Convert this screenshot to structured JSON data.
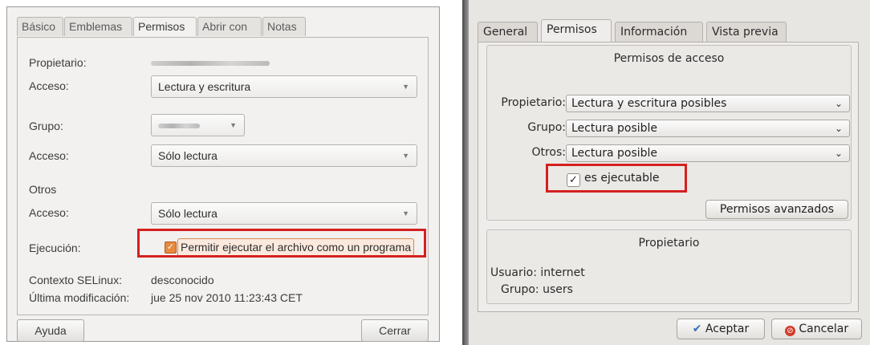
{
  "left_dialog": {
    "tabs": [
      {
        "label": "Básico"
      },
      {
        "label": "Emblemas"
      },
      {
        "label": "Permisos"
      },
      {
        "label": "Abrir con"
      },
      {
        "label": "Notas"
      }
    ],
    "active_tab": "Permisos",
    "owner_label": "Propietario:",
    "owner_access_label": "Acceso:",
    "owner_access_value": "Lectura y escritura",
    "group_label": "Grupo:",
    "group_access_label": "Acceso:",
    "group_access_value": "Sólo lectura",
    "others_label": "Otros",
    "others_access_label": "Acceso:",
    "others_access_value": "Sólo lectura",
    "execution_label": "Ejecución:",
    "execution_checkbox_label": "Permitir ejecutar el archivo como un programa",
    "execution_checked": true,
    "selinux_label": "Contexto SELinux:",
    "selinux_value": "desconocido",
    "modified_label": "Última modificación:",
    "modified_value": "jue 25 nov 2010 11:23:43 CET",
    "help_button": "Ayuda",
    "close_button": "Cerrar"
  },
  "right_dialog": {
    "tabs": [
      {
        "label": "General"
      },
      {
        "label": "Permisos"
      },
      {
        "label": "Información"
      },
      {
        "label": "Vista previa"
      }
    ],
    "active_tab": "Permisos",
    "access_group_title": "Permisos de acceso",
    "owner_label": "Propietario:",
    "owner_value": "Lectura y escritura posibles",
    "group_label": "Grupo:",
    "group_value": "Lectura posible",
    "others_label": "Otros:",
    "others_value": "Lectura posible",
    "executable_label": "es ejecutable",
    "executable_checked": true,
    "advanced_button": "Permisos avanzados",
    "owner_group_title": "Propietario",
    "user_line": "Usuario: internet",
    "group_line": "Grupo: users",
    "ok_button": "Aceptar",
    "cancel_button": "Cancelar"
  },
  "colors": {
    "highlight_red": "#d42020",
    "gnome_check_orange": "#e58a3f",
    "gnome_window": "#f2f1f0",
    "kde_window": "#efedeb"
  }
}
